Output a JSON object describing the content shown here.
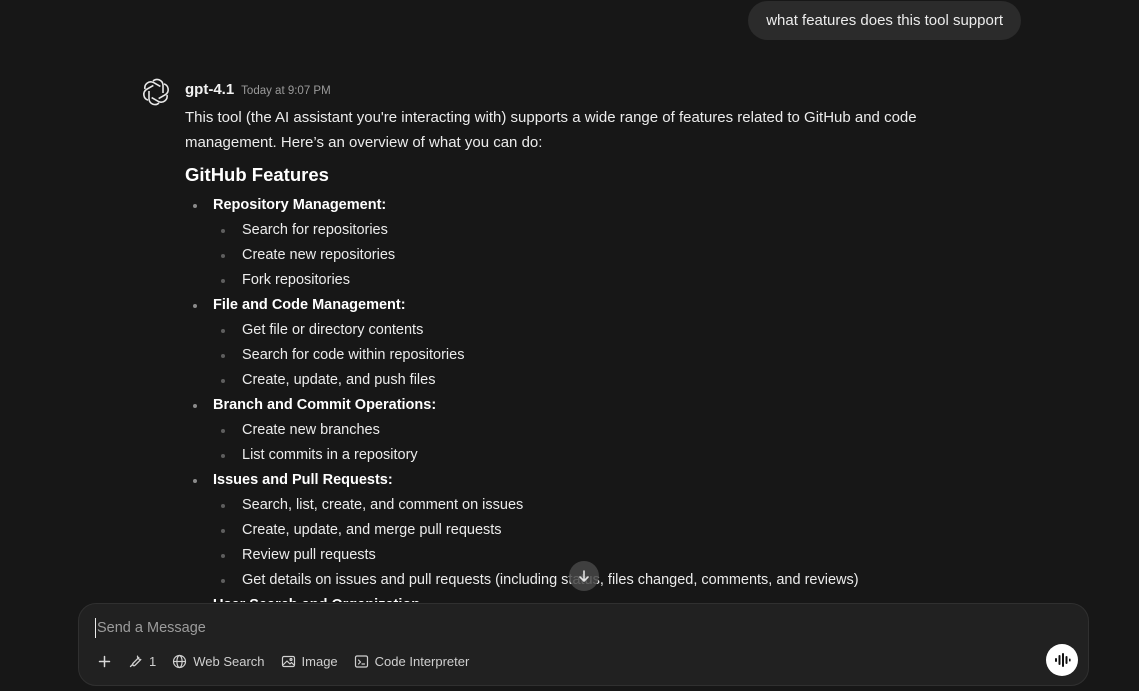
{
  "user_message": "what features does this tool support",
  "assistant": {
    "model_name": "gpt-4.1",
    "timestamp": "Today at 9:07 PM",
    "intro": "This tool (the AI assistant you're interacting with) supports a wide range of features related to GitHub and code management. Here’s an overview of what you can do:",
    "heading": "GitHub Features",
    "groups": [
      {
        "title": "Repository Management:",
        "items": [
          "Search for repositories",
          "Create new repositories",
          "Fork repositories"
        ]
      },
      {
        "title": "File and Code Management:",
        "items": [
          "Get file or directory contents",
          "Search for code within repositories",
          "Create, update, and push files"
        ]
      },
      {
        "title": "Branch and Commit Operations:",
        "items": [
          "Create new branches",
          "List commits in a repository"
        ]
      },
      {
        "title": "Issues and Pull Requests:",
        "items": [
          "Search, list, create, and comment on issues",
          "Create, update, and merge pull requests",
          "Review pull requests",
          "Get details on issues and pull requests (including status, files changed, comments, and reviews)"
        ]
      },
      {
        "title": "User Search and Organization",
        "items": []
      }
    ]
  },
  "composer": {
    "placeholder": "Send a Message",
    "value": "",
    "tools_count": "1",
    "web_search_label": "Web Search",
    "image_label": "Image",
    "code_interpreter_label": "Code Interpreter"
  },
  "icons": {
    "avatar": "openai-logo-icon",
    "scroll": "arrow-down-icon",
    "add": "plus-icon",
    "tools": "wrench-icon",
    "web": "globe-icon",
    "image": "image-icon",
    "code": "terminal-icon",
    "voice": "voice-wave-icon"
  }
}
